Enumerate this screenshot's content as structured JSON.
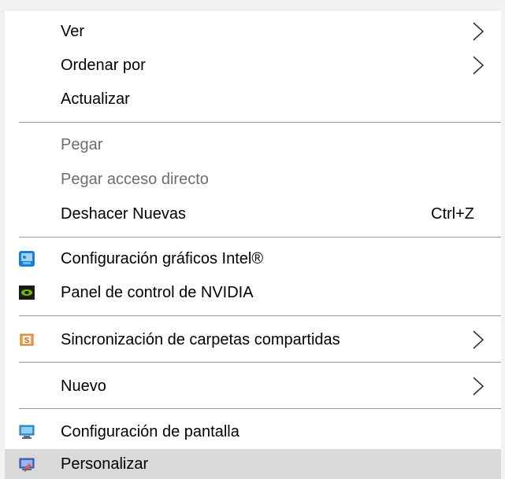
{
  "menu": {
    "items": [
      {
        "label": "Ver"
      },
      {
        "label": "Ordenar por"
      },
      {
        "label": "Actualizar"
      },
      {
        "label": "Pegar"
      },
      {
        "label": "Pegar acceso directo"
      },
      {
        "label": "Deshacer Nuevas",
        "shortcut": "Ctrl+Z"
      },
      {
        "label": "Configuración gráficos Intel®",
        "icon": "intel-graphics-icon"
      },
      {
        "label": "Panel de control de NVIDIA",
        "icon": "nvidia-icon"
      },
      {
        "label": "Sincronización de carpetas compartidas",
        "icon": "sync-folders-icon",
        "icon_letter": "S"
      },
      {
        "label": "Nuevo"
      },
      {
        "label": "Configuración de pantalla",
        "icon": "display-settings-icon"
      },
      {
        "label": "Personalizar",
        "icon": "personalize-icon"
      }
    ]
  },
  "colors": {
    "menu_background": "#ffffff",
    "disabled_text": "#6d6d6d",
    "highlight_background": "#d9d9d9",
    "separator": "#9a9a9a"
  }
}
